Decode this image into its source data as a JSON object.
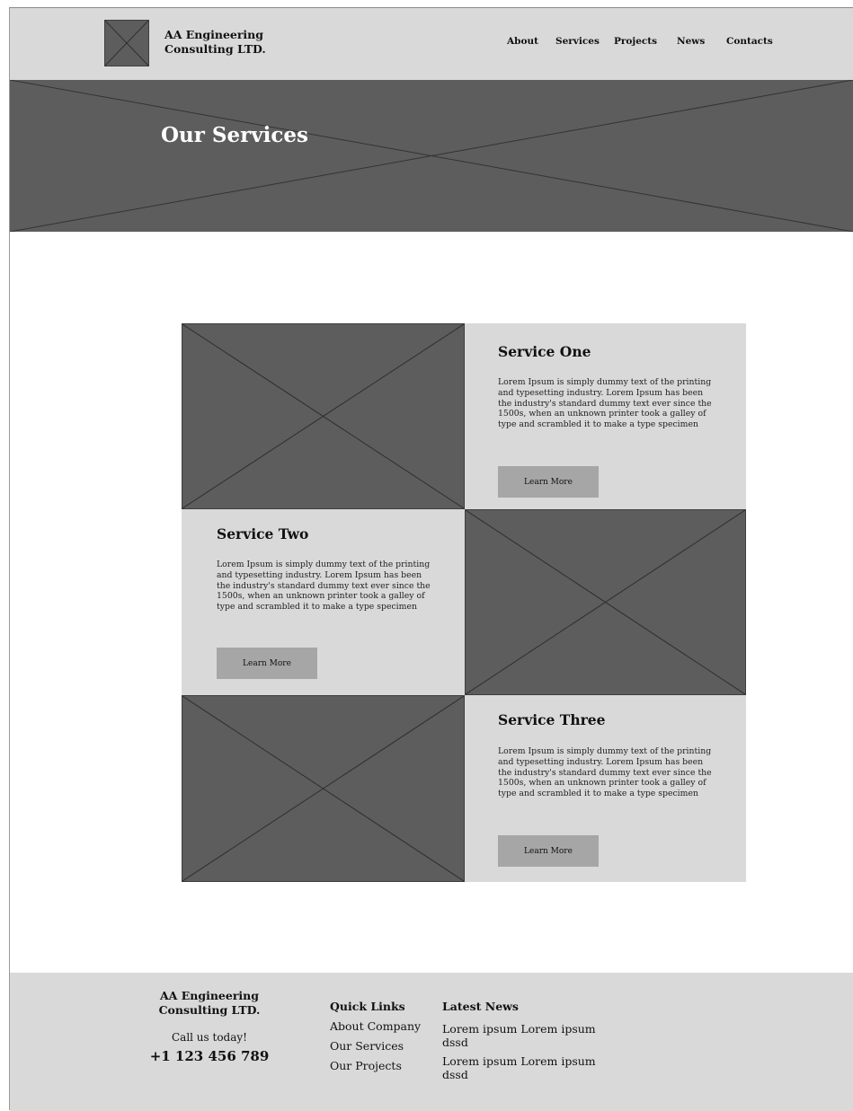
{
  "header": {
    "brand_line1": "AA Engineering",
    "brand_line2": "Consulting LTD.",
    "nav": [
      "About",
      "Services",
      "Projects",
      "News",
      "Contacts"
    ]
  },
  "hero": {
    "title": "Our Services"
  },
  "services": [
    {
      "title": "Service One",
      "text": "Lorem Ipsum is simply dummy text of the printing and typesetting industry. Lorem Ipsum has been the industry's standard dummy text ever since the 1500s, when an unknown printer took a galley of type and scrambled it to make a type specimen",
      "button": "Learn More"
    },
    {
      "title": "Service Two",
      "text": "Lorem Ipsum is simply dummy text of the printing and typesetting industry. Lorem Ipsum has been the industry's standard dummy text ever since the 1500s, when an unknown printer took a galley of type and scrambled it to make a type specimen",
      "button": "Learn More"
    },
    {
      "title": "Service Three",
      "text": "Lorem Ipsum is simply dummy text of the printing and typesetting industry. Lorem Ipsum has been the industry's standard dummy text ever since the 1500s, when an unknown printer took a galley of type and scrambled it to make a type specimen",
      "button": "Learn More"
    }
  ],
  "footer": {
    "brand_line1": "AA Engineering",
    "brand_line2": "Consulting LTD.",
    "call_label": "Call us today!",
    "phone": "+1 123 456 789",
    "quick_links_title": "Quick Links",
    "quick_links": [
      "About Company",
      "Our Services",
      "Our Projects"
    ],
    "latest_news_title": "Latest News",
    "news": [
      "Lorem ipsum Lorem ipsum dssd",
      "Lorem ipsum Lorem ipsum dssd"
    ]
  },
  "colors": {
    "placeholder": "#5d5d5d",
    "panel": "#d9d9d9",
    "button": "#a6a6a6"
  }
}
